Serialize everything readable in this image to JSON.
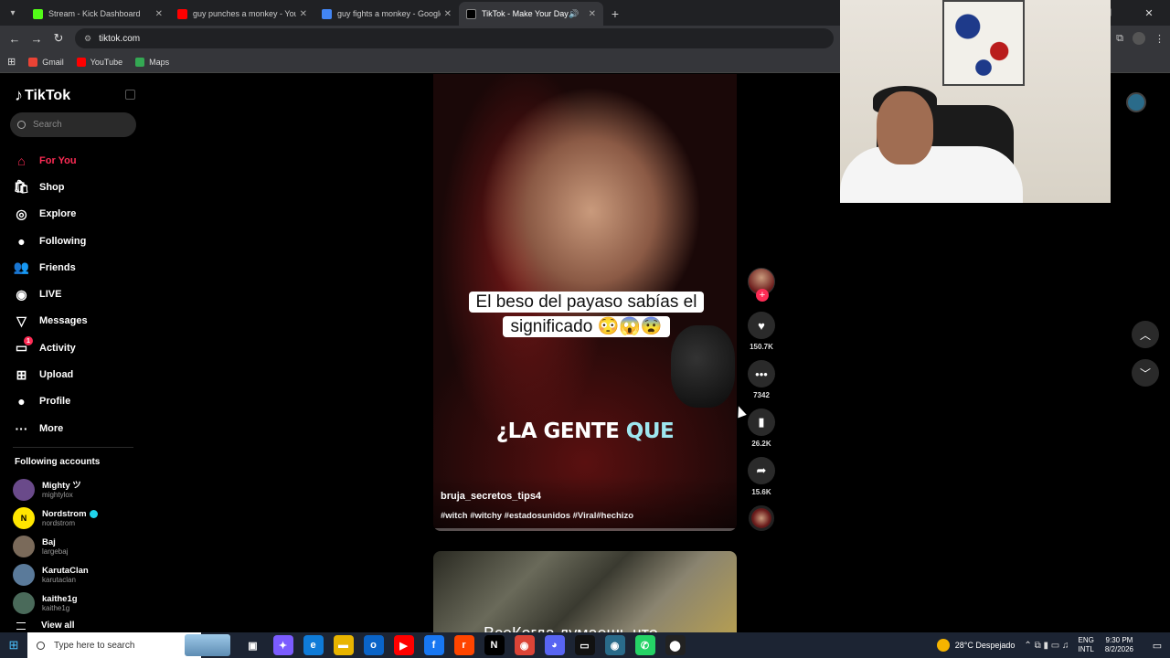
{
  "browser": {
    "tabs": [
      {
        "title": "Stream - Kick Dashboard",
        "color": "#53fc18"
      },
      {
        "title": "guy punches a monkey - YouTube",
        "color": "#ff0000"
      },
      {
        "title": "guy fights a monkey - Google Search",
        "color": "#4285f4"
      },
      {
        "title": "TikTok - Make Your Day",
        "color": "#000000"
      }
    ],
    "url": "tiktok.com",
    "bookmarks": [
      {
        "label": "Gmail",
        "color": "#ea4335"
      },
      {
        "label": "YouTube",
        "color": "#ff0000"
      },
      {
        "label": "Maps",
        "color": "#34a853"
      }
    ]
  },
  "sidebar": {
    "logo": "TikTok",
    "search_placeholder": "Search",
    "nav": [
      {
        "label": "For You",
        "icon": "home-icon",
        "glyph": "⌂",
        "active": true
      },
      {
        "label": "Shop",
        "icon": "shop-bag-icon",
        "glyph": "🛍"
      },
      {
        "label": "Explore",
        "icon": "compass-icon",
        "glyph": "◎"
      },
      {
        "label": "Following",
        "icon": "following-avatar-icon",
        "glyph": "●"
      },
      {
        "label": "Friends",
        "icon": "friends-icon",
        "glyph": "👥"
      },
      {
        "label": "LIVE",
        "icon": "live-icon",
        "glyph": "◉"
      },
      {
        "label": "Messages",
        "icon": "paper-plane-icon",
        "glyph": "▽"
      },
      {
        "label": "Activity",
        "icon": "activity-icon",
        "glyph": "▭",
        "badge": "1"
      },
      {
        "label": "Upload",
        "icon": "upload-plus-icon",
        "glyph": "⊞"
      },
      {
        "label": "Profile",
        "icon": "profile-avatar-icon",
        "glyph": "●"
      },
      {
        "label": "More",
        "icon": "more-dots-icon",
        "glyph": "···"
      }
    ],
    "following_title": "Following accounts",
    "following": [
      {
        "name": "Mighty ツ",
        "handle": "mightylox",
        "color": "#6a4a8a",
        "initial": ""
      },
      {
        "name": "Nordstrom",
        "handle": "nordstrom",
        "color": "#ffe600",
        "initial": "N",
        "verified": true
      },
      {
        "name": "Baj",
        "handle": "largebaj",
        "color": "#7a6a5a",
        "initial": ""
      },
      {
        "name": "KarutaClan",
        "handle": "karutaclan",
        "color": "#5a7a9a",
        "initial": ""
      },
      {
        "name": "kaithe1g",
        "handle": "kaithe1g",
        "color": "#4a6a5a",
        "initial": ""
      }
    ],
    "view_all": "View all"
  },
  "video": {
    "caption": "El beso del payaso sabías el significado 😳😱😨",
    "subtitle_main": "¿LA GENTE ",
    "subtitle_highlight": "QUE",
    "author": "bruja_secretos_tips4",
    "tags": "#witch #witchy #estadosunidos #Viral#hechizo",
    "progress": 0.0,
    "next_text": "ВсеКогда думаешь что"
  },
  "actions": {
    "likes": "150.7K",
    "comments": "7342",
    "saves": "26.2K",
    "shares": "15.6K"
  },
  "taskbar": {
    "search_placeholder": "Type here to search",
    "weather": "28°C  Despejado",
    "lang_top": "ENG",
    "lang_bottom": "INTL",
    "time": "9:30 PM",
    "date": "8/2/2026",
    "apps": [
      {
        "name": "task-view-icon",
        "glyph": "▣",
        "color": "transparent"
      },
      {
        "name": "copilot-icon",
        "glyph": "✦",
        "color": "#7b5cff"
      },
      {
        "name": "edge-icon",
        "glyph": "e",
        "color": "#0f7bd8"
      },
      {
        "name": "file-explorer-icon",
        "glyph": "▬",
        "color": "#e8b400"
      },
      {
        "name": "outlook-icon",
        "glyph": "o",
        "color": "#0a64c8"
      },
      {
        "name": "youtube-app-icon",
        "glyph": "▶",
        "color": "#ff0000"
      },
      {
        "name": "facebook-icon",
        "glyph": "f",
        "color": "#1877f2"
      },
      {
        "name": "reddit-icon",
        "glyph": "r",
        "color": "#ff4500"
      },
      {
        "name": "netflix-icon",
        "glyph": "N",
        "color": "#000000"
      },
      {
        "name": "chrome-icon",
        "glyph": "◉",
        "color": "#db4437"
      },
      {
        "name": "discord-icon",
        "glyph": "◕",
        "color": "#5865f2"
      },
      {
        "name": "terminal-icon",
        "glyph": "▭",
        "color": "#111111"
      },
      {
        "name": "chrome-profile-icon",
        "glyph": "◉",
        "color": "#2a6b8a"
      },
      {
        "name": "whatsapp-icon",
        "glyph": "✆",
        "color": "#25d366"
      },
      {
        "name": "recording-icon",
        "glyph": "⬤",
        "color": "#222222"
      }
    ]
  }
}
